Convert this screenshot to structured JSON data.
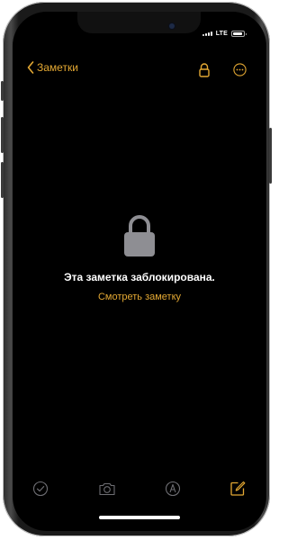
{
  "status_bar": {
    "network": "LTE"
  },
  "nav": {
    "back_label": "Заметки",
    "lock_icon": "lock-icon",
    "more_icon": "more-icon"
  },
  "content": {
    "locked_message": "Эта заметка заблокирована.",
    "view_note_link": "Смотреть заметку"
  },
  "toolbar": {
    "icons": [
      "checklist-icon",
      "camera-icon",
      "markup-icon",
      "compose-icon"
    ]
  },
  "colors": {
    "accent": "#e3a833",
    "background": "#000000",
    "lock_gray": "#8e8e93"
  }
}
